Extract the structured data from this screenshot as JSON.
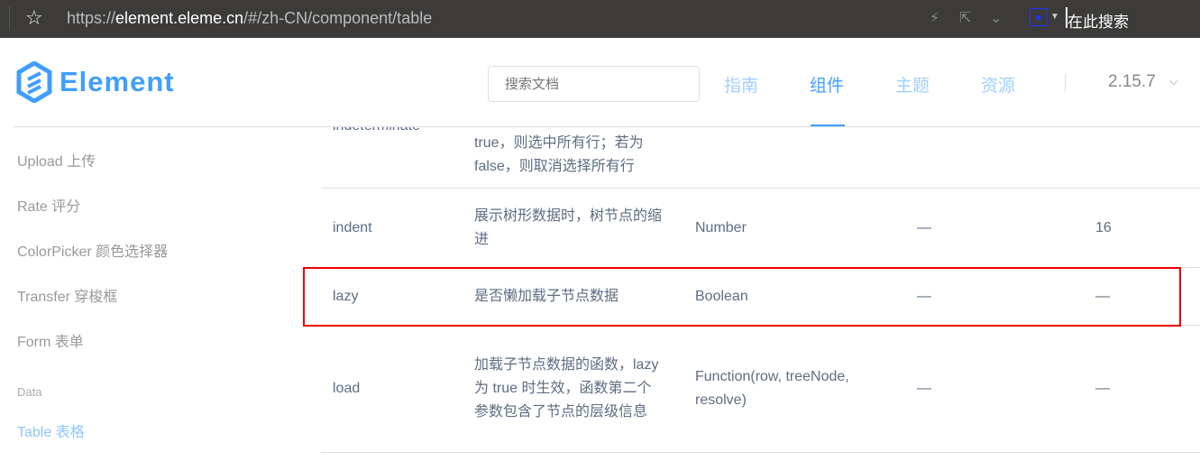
{
  "browser": {
    "url_prefix": "https://",
    "url_domain": "element.eleme.cn",
    "url_path": "/#/zh-CN/component/table",
    "search_placeholder": "在此搜索"
  },
  "header": {
    "logo": "Element",
    "search_placeholder": "搜索文档",
    "nav": [
      "指南",
      "组件",
      "主题",
      "资源"
    ],
    "active_nav": "组件",
    "version": "2.15.7"
  },
  "sidebar": {
    "items": [
      "Upload 上传",
      "Rate 评分",
      "ColorPicker 颜色选择器",
      "Transfer 穿梭框",
      "Form 表单"
    ],
    "group": "Data",
    "active": "Table 表格"
  },
  "table": {
    "rows": [
      {
        "name": "indeterminate",
        "desc": "true，则选中所有行；若为 false，则取消选择所有行",
        "type": "",
        "options": "",
        "default": ""
      },
      {
        "name": "indent",
        "desc": "展示树形数据时，树节点的缩进",
        "type": "Number",
        "options": "—",
        "default": "16"
      },
      {
        "name": "lazy",
        "desc": "是否懒加载子节点数据",
        "type": "Boolean",
        "options": "—",
        "default": "—"
      },
      {
        "name": "load",
        "desc": "加载子节点数据的函数，lazy 为 true 时生效，函数第二个参数包含了节点的层级信息",
        "type": "Function(row, treeNode, resolve)",
        "options": "—",
        "default": "—"
      }
    ]
  },
  "colors": {
    "accent": "#409eff",
    "highlight": "#e00000"
  }
}
